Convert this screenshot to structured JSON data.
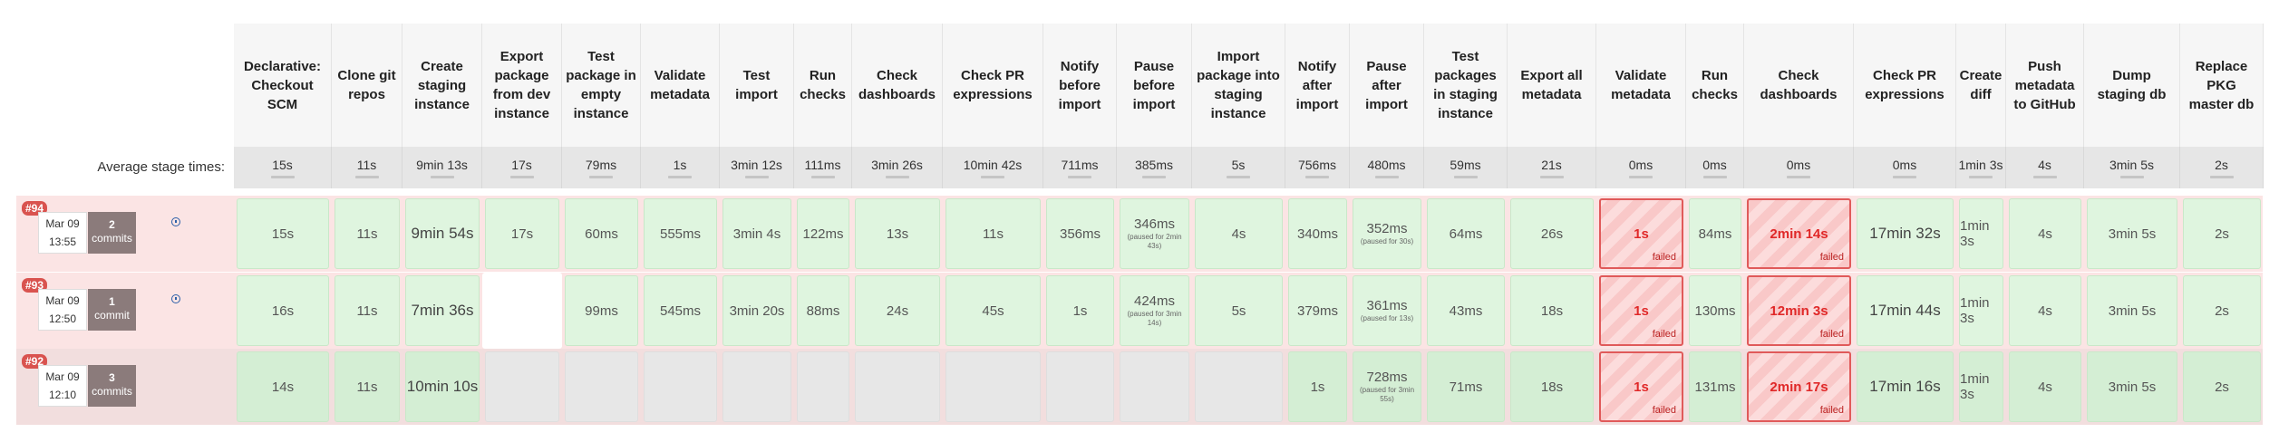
{
  "average_label": "Average stage times:",
  "stages": [
    {
      "label": "Declarative: Checkout SCM",
      "avg": "15s"
    },
    {
      "label": "Clone git repos",
      "avg": "11s"
    },
    {
      "label": "Create staging instance",
      "avg": "9min 13s"
    },
    {
      "label": "Export package from dev instance",
      "avg": "17s"
    },
    {
      "label": "Test package in empty instance",
      "avg": "79ms"
    },
    {
      "label": "Validate metadata",
      "avg": "1s"
    },
    {
      "label": "Test import",
      "avg": "3min 12s"
    },
    {
      "label": "Run checks",
      "avg": "111ms"
    },
    {
      "label": "Check dashboards",
      "avg": "3min 26s"
    },
    {
      "label": "Check PR expressions",
      "avg": "10min 42s"
    },
    {
      "label": "Notify before import",
      "avg": "711ms"
    },
    {
      "label": "Pause before import",
      "avg": "385ms"
    },
    {
      "label": "Import package into staging instance",
      "avg": "5s"
    },
    {
      "label": "Notify after import",
      "avg": "756ms"
    },
    {
      "label": "Pause after import",
      "avg": "480ms"
    },
    {
      "label": "Test packages in staging instance",
      "avg": "59ms"
    },
    {
      "label": "Export all metadata",
      "avg": "21s"
    },
    {
      "label": "Validate metadata",
      "avg": "0ms"
    },
    {
      "label": "Run checks",
      "avg": "0ms"
    },
    {
      "label": "Check dashboards",
      "avg": "0ms"
    },
    {
      "label": "Check PR expressions",
      "avg": "0ms"
    },
    {
      "label": "Create diff",
      "avg": "1min 3s"
    },
    {
      "label": "Push metadata to GitHub",
      "avg": "4s"
    },
    {
      "label": "Dump staging db",
      "avg": "3min 5s"
    },
    {
      "label": "Replace PKG master db",
      "avg": "2s"
    }
  ],
  "failed_label": "failed",
  "builds": [
    {
      "badge": "#94",
      "date": "Mar 09",
      "time": "13:55",
      "commits_count": "2",
      "commits_label": "commits",
      "info_icon": "info-icon",
      "cells": [
        {
          "text": "15s",
          "status": "ok"
        },
        {
          "text": "11s",
          "status": "ok"
        },
        {
          "text": "9min 54s",
          "status": "ok",
          "big": true
        },
        {
          "text": "17s",
          "status": "ok"
        },
        {
          "text": "60ms",
          "status": "ok"
        },
        {
          "text": "555ms",
          "status": "ok"
        },
        {
          "text": "3min 4s",
          "status": "ok"
        },
        {
          "text": "122ms",
          "status": "ok"
        },
        {
          "text": "13s",
          "status": "ok"
        },
        {
          "text": "11s",
          "status": "ok"
        },
        {
          "text": "356ms",
          "status": "ok"
        },
        {
          "text": "346ms",
          "status": "ok",
          "sub": "(paused for 2min 43s)"
        },
        {
          "text": "4s",
          "status": "ok"
        },
        {
          "text": "340ms",
          "status": "ok"
        },
        {
          "text": "352ms",
          "status": "ok",
          "sub": "(paused for 30s)"
        },
        {
          "text": "64ms",
          "status": "ok"
        },
        {
          "text": "26s",
          "status": "ok"
        },
        {
          "text": "1s",
          "status": "fail"
        },
        {
          "text": "84ms",
          "status": "ok"
        },
        {
          "text": "2min 14s",
          "status": "fail"
        },
        {
          "text": "17min 32s",
          "status": "ok",
          "big": true
        },
        {
          "text": "1min 3s",
          "status": "ok"
        },
        {
          "text": "4s",
          "status": "ok"
        },
        {
          "text": "3min 5s",
          "status": "ok"
        },
        {
          "text": "2s",
          "status": "ok"
        }
      ]
    },
    {
      "badge": "#93",
      "date": "Mar 09",
      "time": "12:50",
      "commits_count": "1",
      "commits_label": "commit",
      "info_icon": "info-icon",
      "cells": [
        {
          "text": "16s",
          "status": "ok"
        },
        {
          "text": "11s",
          "status": "ok"
        },
        {
          "text": "7min 36s",
          "status": "ok",
          "big": true
        },
        {
          "text": "",
          "status": "empty"
        },
        {
          "text": "99ms",
          "status": "ok"
        },
        {
          "text": "545ms",
          "status": "ok"
        },
        {
          "text": "3min 20s",
          "status": "ok"
        },
        {
          "text": "88ms",
          "status": "ok"
        },
        {
          "text": "24s",
          "status": "ok"
        },
        {
          "text": "45s",
          "status": "ok"
        },
        {
          "text": "1s",
          "status": "ok"
        },
        {
          "text": "424ms",
          "status": "ok",
          "sub": "(paused for 3min 14s)"
        },
        {
          "text": "5s",
          "status": "ok"
        },
        {
          "text": "379ms",
          "status": "ok"
        },
        {
          "text": "361ms",
          "status": "ok",
          "sub": "(paused for 13s)"
        },
        {
          "text": "43ms",
          "status": "ok"
        },
        {
          "text": "18s",
          "status": "ok"
        },
        {
          "text": "1s",
          "status": "fail"
        },
        {
          "text": "130ms",
          "status": "ok"
        },
        {
          "text": "12min 3s",
          "status": "fail"
        },
        {
          "text": "17min 44s",
          "status": "ok",
          "big": true
        },
        {
          "text": "1min 3s",
          "status": "ok"
        },
        {
          "text": "4s",
          "status": "ok"
        },
        {
          "text": "3min 5s",
          "status": "ok"
        },
        {
          "text": "2s",
          "status": "ok"
        }
      ]
    },
    {
      "badge": "#92",
      "date": "Mar 09",
      "time": "12:10",
      "commits_count": "3",
      "commits_label": "commits",
      "info_icon": "",
      "cells": [
        {
          "text": "14s",
          "status": "ok"
        },
        {
          "text": "11s",
          "status": "ok"
        },
        {
          "text": "10min 10s",
          "status": "ok",
          "big": true
        },
        {
          "text": "",
          "status": "grey"
        },
        {
          "text": "",
          "status": "grey"
        },
        {
          "text": "",
          "status": "grey"
        },
        {
          "text": "",
          "status": "grey"
        },
        {
          "text": "",
          "status": "grey"
        },
        {
          "text": "",
          "status": "grey"
        },
        {
          "text": "",
          "status": "grey"
        },
        {
          "text": "",
          "status": "grey"
        },
        {
          "text": "",
          "status": "grey"
        },
        {
          "text": "",
          "status": "grey"
        },
        {
          "text": "1s",
          "status": "ok"
        },
        {
          "text": "728ms",
          "status": "ok",
          "sub": "(paused for 3min 55s)"
        },
        {
          "text": "71ms",
          "status": "ok"
        },
        {
          "text": "18s",
          "status": "ok"
        },
        {
          "text": "1s",
          "status": "fail"
        },
        {
          "text": "131ms",
          "status": "ok"
        },
        {
          "text": "2min 17s",
          "status": "fail"
        },
        {
          "text": "17min 16s",
          "status": "ok",
          "big": true
        },
        {
          "text": "1min 3s",
          "status": "ok"
        },
        {
          "text": "4s",
          "status": "ok"
        },
        {
          "text": "3min 5s",
          "status": "ok"
        },
        {
          "text": "2s",
          "status": "ok"
        }
      ]
    }
  ],
  "colors": {
    "fail_border": "#e05a5a",
    "fail_text": "#e02828",
    "ok_bg": "#dff5df",
    "badge": "#d9534f",
    "row_fail_bg": "#fbe3e3",
    "row_grey_bg": "#f0dada"
  }
}
